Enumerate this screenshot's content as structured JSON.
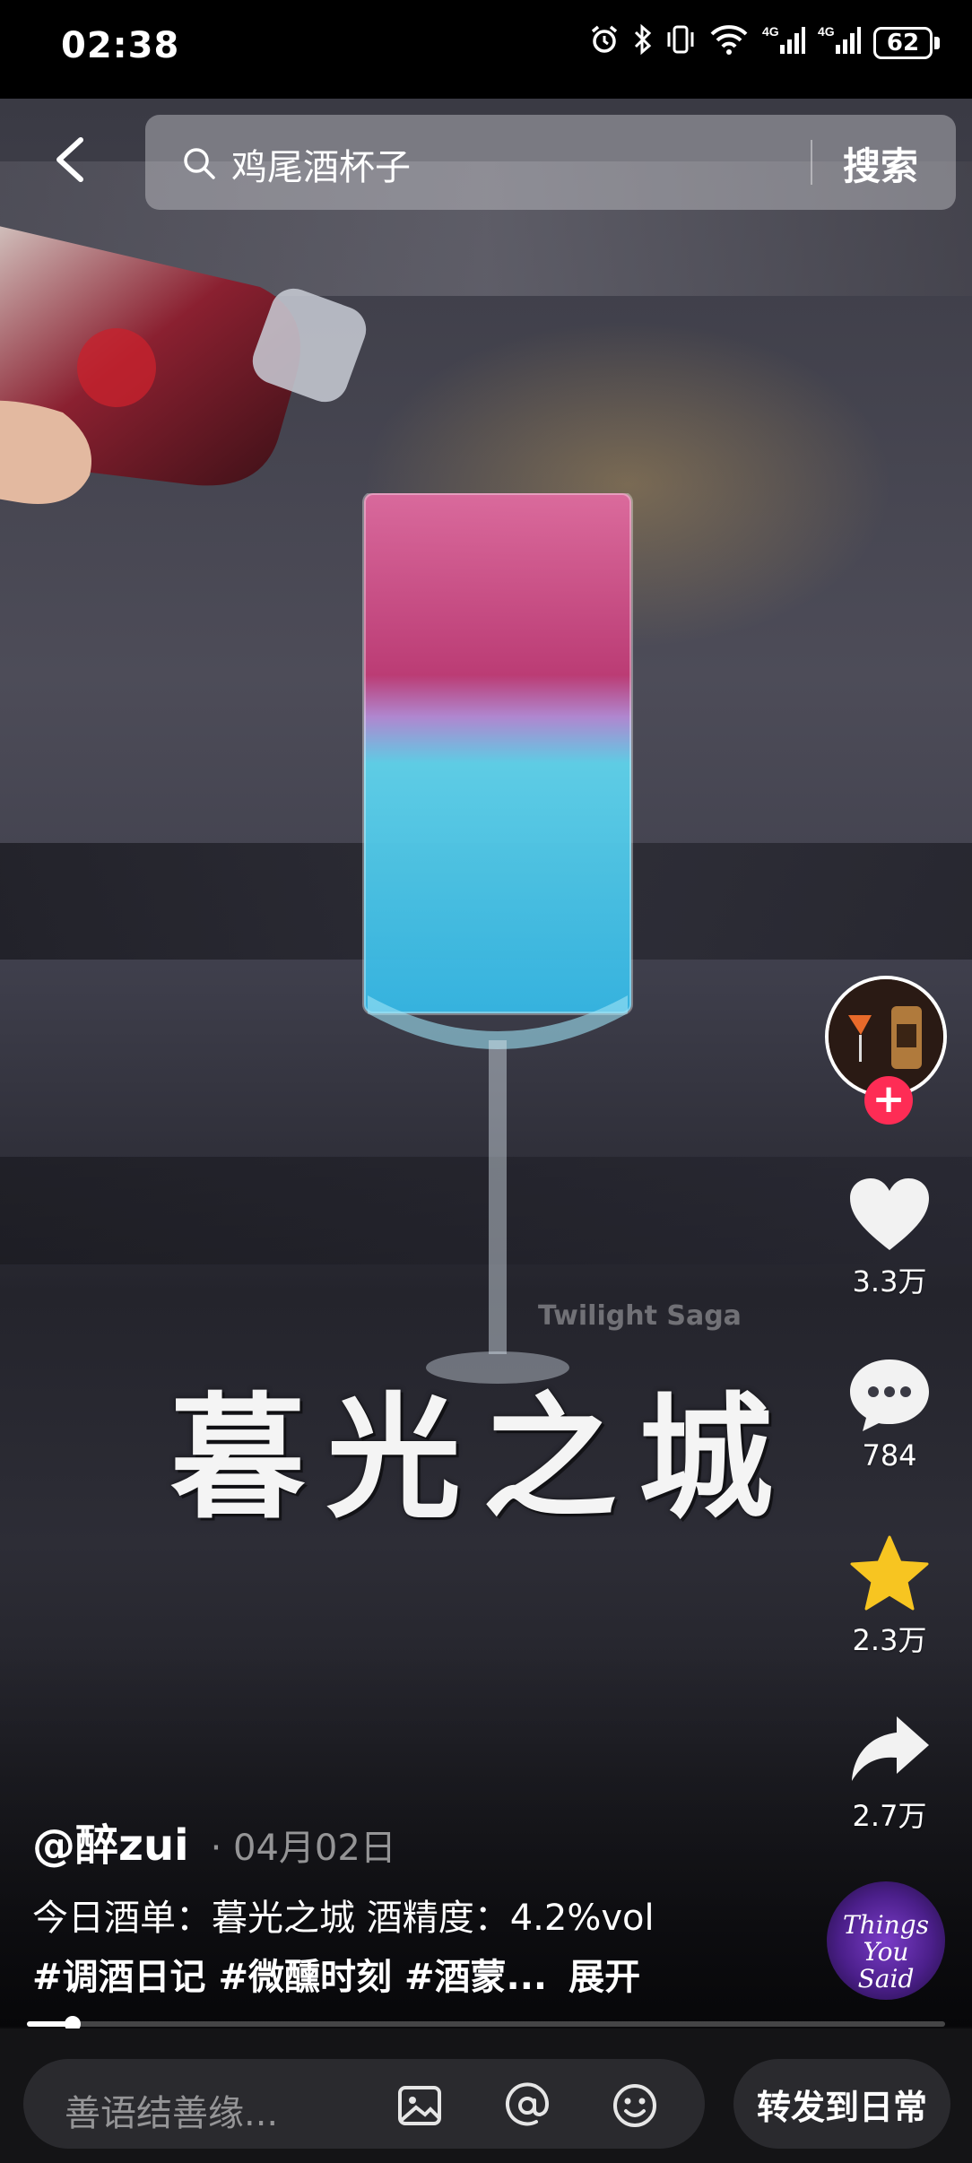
{
  "status_bar": {
    "time": "02:38",
    "battery": "62"
  },
  "search": {
    "query": "鸡尾酒杯子",
    "button_label": "搜索"
  },
  "video": {
    "title_overlay": "暮光之城",
    "subtitle_overlay": "Twilight Saga"
  },
  "sidebar": {
    "follow_label": "+",
    "like_count": "3.3万",
    "comment_count": "784",
    "favorite_count": "2.3万",
    "share_count": "2.7万",
    "music_disc_text": "Things You Said"
  },
  "caption": {
    "author": "@醉zui",
    "date": "· 04月02日",
    "description": "今日酒单：暮光之城 酒精度：4.2%vol",
    "tags": [
      "#调酒日记",
      "#微醺时刻",
      "#酒蒙..."
    ],
    "expand_label": "展开"
  },
  "progress": {
    "played_fraction": 0.05
  },
  "bottom_bar": {
    "comment_placeholder": "善语结善缘...",
    "share_daily_label": "转发到日常"
  },
  "colors": {
    "accent_red": "#fe2c55",
    "favorite_yellow": "#f7c521"
  }
}
